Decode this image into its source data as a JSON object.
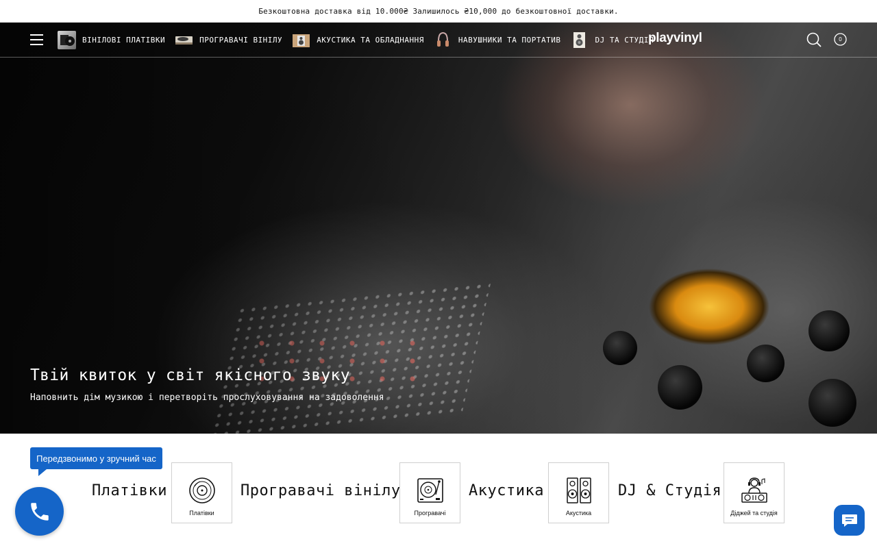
{
  "announcement": {
    "text": "Безкоштовна доставка від 10.000₴ Залишилось ₴10,000 до безкоштовної доставки."
  },
  "header": {
    "menu_icon": "hamburger-menu-icon",
    "nav": [
      {
        "label": "ВІНІЛОВІ ПЛАТІВКИ",
        "thumb": "vinyl-records-thumbnail"
      },
      {
        "label": "ПРОГРАВАЧІ ВІНІЛУ",
        "thumb": "turntable-thumbnail"
      },
      {
        "label": "АКУСТИКА ТА ОБЛАДНАННЯ",
        "thumb": "speaker-thumbnail"
      },
      {
        "label": "НАВУШНИКИ ТА ПОРТАТИВ",
        "thumb": "headphones-thumbnail"
      },
      {
        "label": "DJ ТА СТУДІЯ",
        "thumb": "dj-speaker-thumbnail"
      }
    ],
    "logo": "playvinyl",
    "search_icon": "search-icon",
    "cart_icon": "cart-icon",
    "cart_count": "0"
  },
  "hero": {
    "headline": "Твій квиток у світ якісного звуку",
    "subheadline": "Наповнить дім музикою і перетворіть прослуховування на задоволення"
  },
  "categories": [
    {
      "title": "Платівки",
      "card_label": "Платівки",
      "icon": "vinyl-record-icon"
    },
    {
      "title": "Програвачі вінілу",
      "card_label": "Програвачі",
      "icon": "turntable-icon"
    },
    {
      "title": "Акустика",
      "card_label": "Акустика",
      "icon": "speakers-icon"
    },
    {
      "title": "DJ & Студія",
      "card_label": "Діджей та студія",
      "icon": "dj-icon"
    }
  ],
  "widgets": {
    "callback_tooltip": "Передзвонимо у зручний час",
    "callback_icon": "phone-icon",
    "chat_icon": "chat-icon"
  },
  "colors": {
    "accent": "#1565c8",
    "text": "#111111",
    "header_text": "#ffffff"
  }
}
